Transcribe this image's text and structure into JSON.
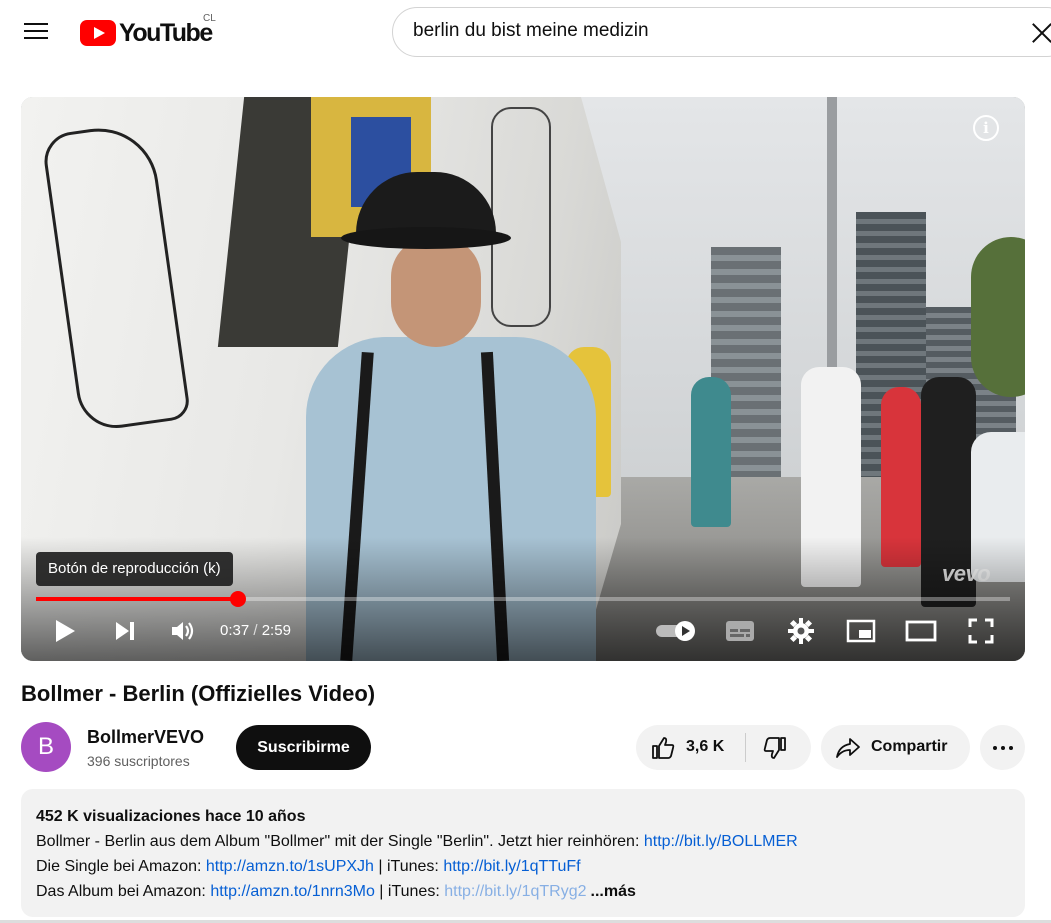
{
  "header": {
    "logo_text": "YouTube",
    "country_code": "CL",
    "search_value": "berlin du bist meine medizin"
  },
  "player": {
    "tooltip": "Botón de reproducción (k)",
    "watermark": "vevo",
    "current_time": "0:37",
    "separator": "/",
    "duration": "2:59",
    "progress_fraction": 0.207,
    "accent_color": "#ff0000"
  },
  "video": {
    "title": "Bollmer - Berlin (Offizielles Video)",
    "channel": {
      "avatar_letter": "B",
      "name": "BollmerVEVO",
      "subscribers": "396 suscriptores"
    },
    "subscribe_label": "Suscribirme",
    "likes": "3,6 K",
    "share_label": "Compartir"
  },
  "description": {
    "meta": "452 K visualizaciones  hace 10 años",
    "line1_text": "Bollmer - Berlin aus dem Album \"Bollmer\" mit der Single \"Berlin\". Jetzt hier reinhören: ",
    "line1_link": "http://bit.ly/BOLLMER",
    "line2_text": "Die Single bei Amazon: ",
    "line2_link1": "http://amzn.to/1sUPXJh",
    "line2_mid": " | iTunes: ",
    "line2_link2": "http://bit.ly/1qTTuFf",
    "line3_text": "Das Album bei Amazon: ",
    "line3_link1": "http://amzn.to/1nrn3Mo",
    "line3_mid": " | iTunes: ",
    "line3_link2": "http://bit.ly/1qTRyg2",
    "more_label": "...más"
  }
}
